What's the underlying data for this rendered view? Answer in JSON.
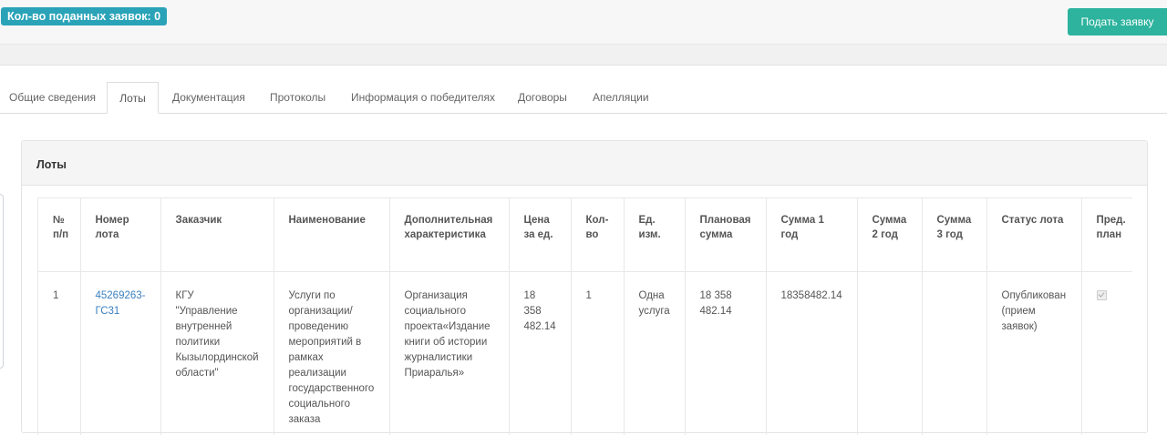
{
  "header": {
    "applications_count_label": "Кол-во поданных заявок: 0",
    "submit_button_label": "Подать заявку"
  },
  "tabs": [
    {
      "label": "Общие сведения"
    },
    {
      "label": "Лоты"
    },
    {
      "label": "Документация"
    },
    {
      "label": "Протоколы"
    },
    {
      "label": "Информация о победителях"
    },
    {
      "label": "Договоры"
    },
    {
      "label": "Апелляции"
    }
  ],
  "active_tab": "Лоты",
  "panel": {
    "title": "Лоты"
  },
  "table": {
    "columns": [
      "№ п/п",
      "Номер лота",
      "Заказчик",
      "Наименование",
      "Дополнительная характеристика",
      "Цена за ед.",
      "Кол-во",
      "Ед. изм.",
      "Плановая сумма",
      "Сумма 1 год",
      "Сумма 2 год",
      "Сумма 3 год",
      "Статус лота",
      "Пред. план"
    ],
    "rows": [
      {
        "num": "1",
        "lot_number": "45269263-ГС31",
        "customer": "КГУ \"Управление внутренней политики Кызылординской области\"",
        "name": "Услуги по организации/ проведению мероприятий в рамках реализации государственного социального заказа",
        "extra": "Организация социального проекта«Издание книги об истории журналистики Приаралья»",
        "unit_price": "18 358 482.14",
        "qty": "1",
        "unit": "Одна услуга",
        "planned_sum": "18 358 482.14",
        "sum_year1": "18358482.14",
        "sum_year2": "",
        "sum_year3": "",
        "status": "Опубликован (прием заявок)",
        "prev_plan_checked": true
      }
    ]
  }
}
